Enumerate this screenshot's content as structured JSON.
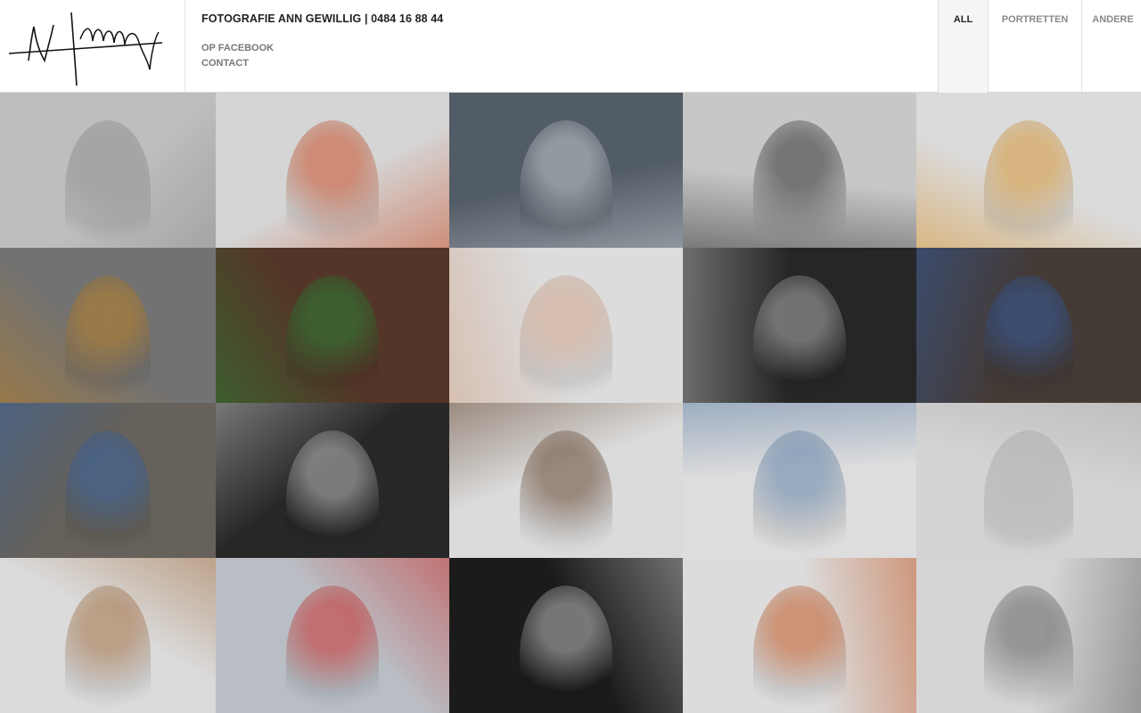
{
  "header": {
    "title": "FOTOGRAFIE ANN GEWILLIG | 0484 16 88 44",
    "links": [
      "OP FACEBOOK",
      "CONTACT"
    ]
  },
  "nav": {
    "tabs": [
      "ALL",
      "PORTRETTEN",
      "ANDERE"
    ],
    "active": "ALL"
  },
  "gallery": {
    "columns": 5,
    "rows": 4,
    "photos": [
      {
        "name": "photo-snow-texture",
        "colors": [
          "#cfcfcf",
          "#9a9a9a"
        ]
      },
      {
        "name": "photo-girl-with-dog",
        "colors": [
          "#e8e8e8",
          "#d9552a"
        ]
      },
      {
        "name": "photo-man-at-office-desk",
        "colors": [
          "#5a6470",
          "#d7dde2"
        ]
      },
      {
        "name": "photo-boy-bw-portrait",
        "colors": [
          "#d8d8d8",
          "#3a3a3a"
        ]
      },
      {
        "name": "photo-baby-clothesline-fiene",
        "colors": [
          "#eeeeee",
          "#e9a43a"
        ]
      },
      {
        "name": "photo-lichen-rock",
        "colors": [
          "#7c7c7c",
          "#c98a2a"
        ]
      },
      {
        "name": "photo-laughing-boy-closeup",
        "colors": [
          "#5b3b2b",
          "#2f8a3b"
        ]
      },
      {
        "name": "photo-girl-headband",
        "colors": [
          "#efefef",
          "#e3b59a"
        ]
      },
      {
        "name": "photo-women-group-bw",
        "colors": [
          "#2a2a2a",
          "#bdbdbd"
        ]
      },
      {
        "name": "photo-boys-on-bridge",
        "colors": [
          "#4a403c",
          "#3a62a8"
        ]
      },
      {
        "name": "photo-woman-call-center",
        "colors": [
          "#6f6a62",
          "#3c6db0"
        ]
      },
      {
        "name": "photo-curly-boy-bw",
        "colors": [
          "#2b2b2b",
          "#cfcfcf"
        ]
      },
      {
        "name": "photo-boy-with-scarf",
        "colors": [
          "#eeeeee",
          "#6b4a32"
        ]
      },
      {
        "name": "photo-six-brothers",
        "colors": [
          "#f0f0f0",
          "#6d8fb8"
        ]
      },
      {
        "name": "photo-baby-bw",
        "colors": [
          "#e5e5e5",
          "#bdbdbd"
        ]
      },
      {
        "name": "photo-boy-gray-scarf",
        "colors": [
          "#eeeeee",
          "#b07a4a"
        ]
      },
      {
        "name": "photo-meeting-camera",
        "colors": [
          "#c9cfd6",
          "#d9332f"
        ]
      },
      {
        "name": "photo-blond-boy-laughing-bw",
        "colors": [
          "#1e1e1e",
          "#cfcfcf"
        ]
      },
      {
        "name": "photo-red-haired-toddler",
        "colors": [
          "#efefef",
          "#d2622a"
        ]
      },
      {
        "name": "photo-family-group-bw",
        "colors": [
          "#e8e8e8",
          "#6a6a6a"
        ]
      }
    ]
  }
}
